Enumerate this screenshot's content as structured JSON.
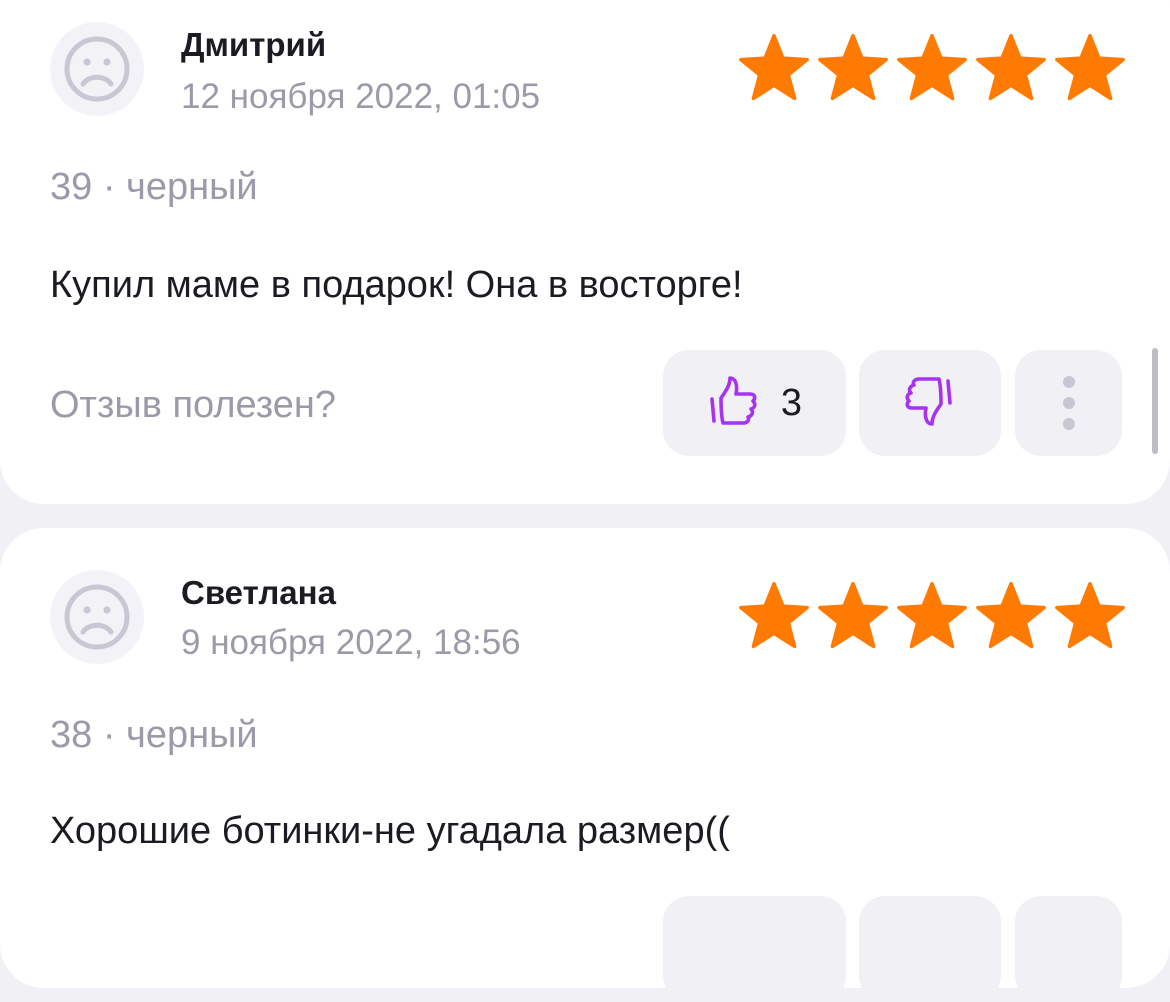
{
  "reviews": [
    {
      "author": "Дмитрий",
      "date": "12 ноября 2022, 01:05",
      "rating": 5,
      "variant": "39 · черный",
      "text": "Купил маме в подарок! Она в восторге!",
      "helpful_label": "Отзыв полезен?",
      "likes": "3"
    },
    {
      "author": "Светлана",
      "date": "9 ноября 2022, 18:56",
      "rating": 5,
      "variant": "38 · черный",
      "text": "Хорошие ботинки-не угадала размер(("
    }
  ],
  "colors": {
    "star": "#ff7a00",
    "accent": "#a733f0",
    "muted_text": "#9c9aa8",
    "button_bg": "#f1f0f5",
    "page_bg": "#f1f0f5"
  },
  "icons": {
    "avatar": "sad-face-icon",
    "like": "thumbs-up-icon",
    "dislike": "thumbs-down-icon",
    "more": "more-vertical-icon",
    "rating": "star-icon"
  }
}
